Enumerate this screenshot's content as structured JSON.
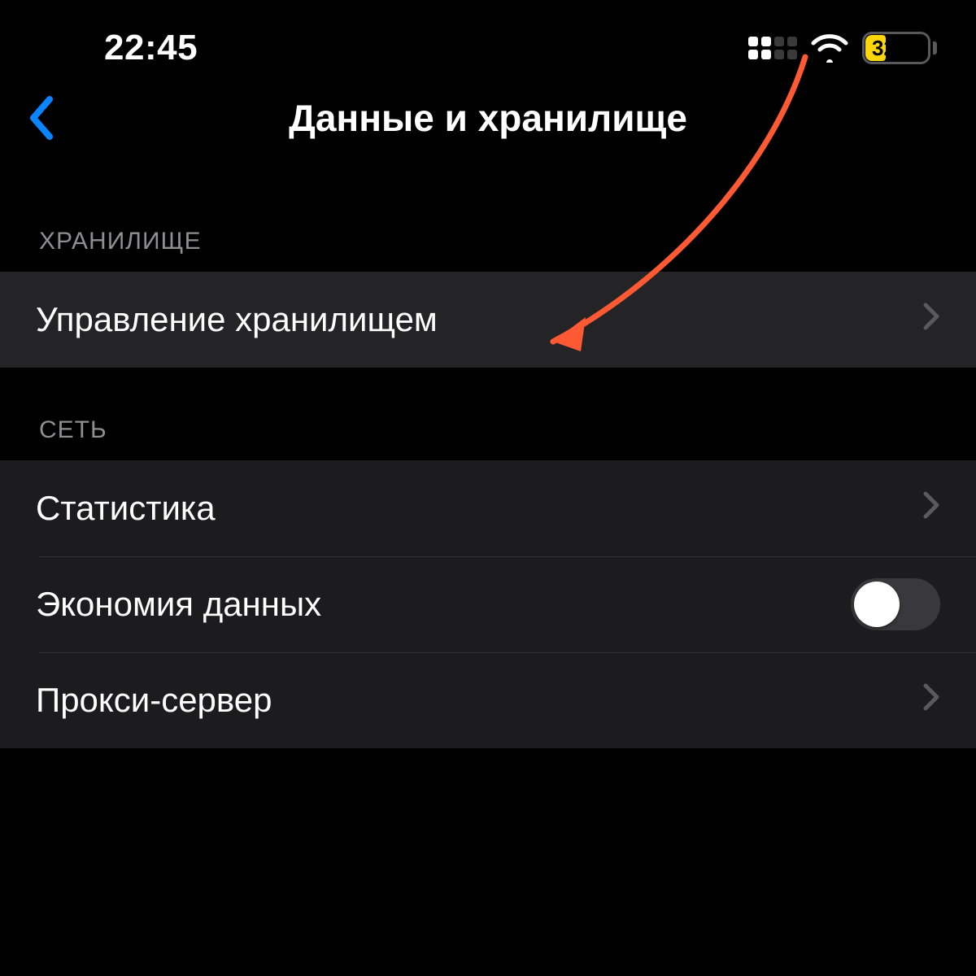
{
  "status": {
    "time": "22:45",
    "battery_level": "32"
  },
  "header": {
    "title": "Данные и хранилище"
  },
  "sections": {
    "storage": {
      "header": "ХРАНИЛИЩЕ",
      "items": {
        "manage_storage": "Управление хранилищем"
      }
    },
    "network": {
      "header": "СЕТЬ",
      "items": {
        "statistics": "Статистика",
        "data_saver": "Экономия данных",
        "proxy": "Прокси-сервер"
      },
      "data_saver_on": false
    }
  }
}
